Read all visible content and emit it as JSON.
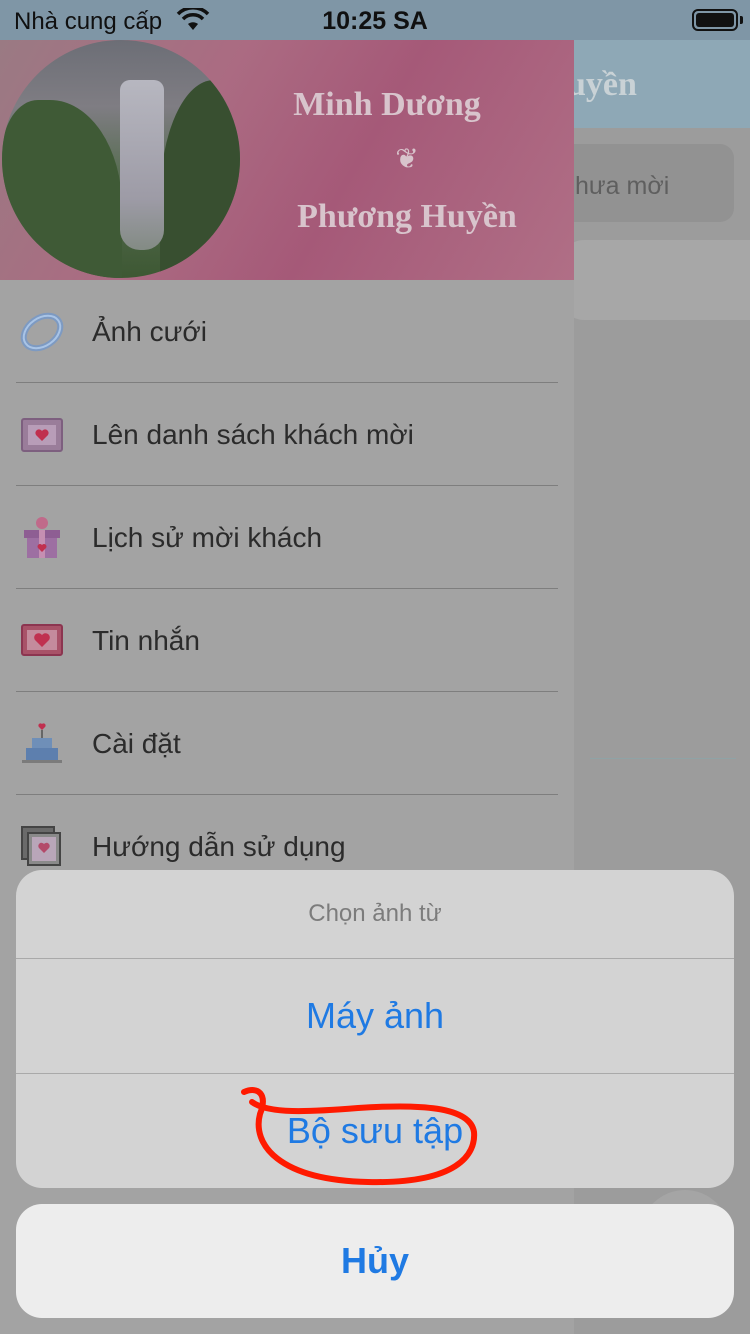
{
  "status_bar": {
    "carrier": "Nhà cung cấp",
    "time": "10:25 SA"
  },
  "background": {
    "header_title": "uyền",
    "tab_label": "hưa mời"
  },
  "drawer": {
    "couple_name_1": "Minh Dương",
    "couple_symbol": "❦",
    "couple_name_2": "Phương Huyền",
    "items": [
      {
        "label": "Ảnh cưới",
        "icon": "ring-icon"
      },
      {
        "label": "Lên danh sách khách mời",
        "icon": "envelope-heart-icon"
      },
      {
        "label": "Lịch sử mời khách",
        "icon": "gift-box-icon"
      },
      {
        "label": "Tin nhắn",
        "icon": "message-heart-icon"
      },
      {
        "label": "Cài đặt",
        "icon": "cake-icon"
      },
      {
        "label": "Hướng dẫn sử dụng",
        "icon": "photo-frames-icon"
      }
    ]
  },
  "action_sheet": {
    "title": "Chọn ảnh từ",
    "camera_label": "Máy ảnh",
    "library_label": "Bộ sưu tập",
    "cancel_label": "Hủy"
  },
  "colors": {
    "accent": "#1f7ae3",
    "annotation": "#ff1a00"
  }
}
